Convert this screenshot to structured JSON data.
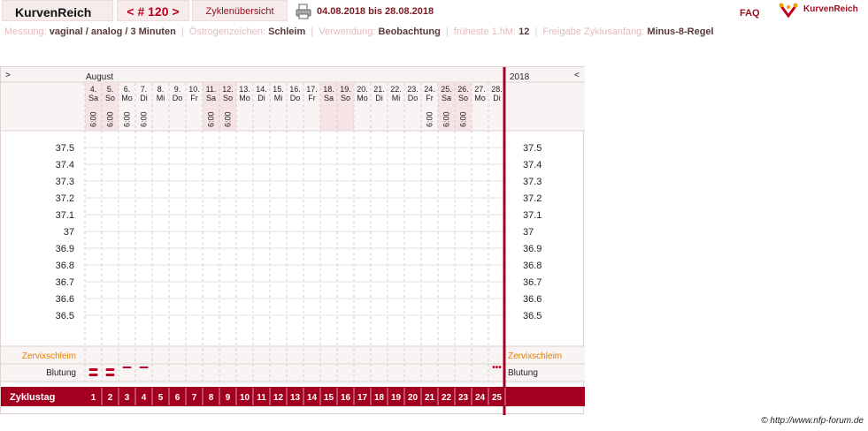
{
  "header": {
    "logo": "KurvenReich",
    "cycle_nav": "< # 120 >",
    "overview_button": "Zyklenübersicht",
    "date_range": "04.08.2018 bis 28.08.2018",
    "faq": "FAQ",
    "brand": "KurvenReich"
  },
  "info": {
    "measurement_label": "Messung:",
    "measurement_value": "vaginal / analog / 3 Minuten",
    "estrogen_label": "Östrogenzeichen:",
    "estrogen_value": "Schleim",
    "usage_label": "Verwendung:",
    "usage_value": "Beobachtung",
    "earliest_label": "früheste 1.hM:",
    "earliest_value": "12",
    "release_label": "Freigabe Zyklusanfang:",
    "release_value": "Minus-8-Regel"
  },
  "chart": {
    "nav_left": ">",
    "nav_right": "<",
    "month": "August",
    "year": "2018",
    "row_cervix": "Zervixschleim",
    "row_bleeding": "Blutung",
    "row_cycleday": "Zyklustag",
    "days": [
      {
        "d": "4.",
        "w": "Sa",
        "time": "6:00",
        "weekend": true
      },
      {
        "d": "5.",
        "w": "So",
        "time": "6:00",
        "weekend": true
      },
      {
        "d": "6.",
        "w": "Mo",
        "time": "6:00",
        "weekend": false
      },
      {
        "d": "7.",
        "w": "Di",
        "time": "6:00",
        "weekend": false
      },
      {
        "d": "8.",
        "w": "Mi",
        "time": "",
        "weekend": false
      },
      {
        "d": "9.",
        "w": "Do",
        "time": "",
        "weekend": false
      },
      {
        "d": "10.",
        "w": "Fr",
        "time": "",
        "weekend": false
      },
      {
        "d": "11.",
        "w": "Sa",
        "time": "6:00",
        "weekend": true
      },
      {
        "d": "12.",
        "w": "So",
        "time": "6:00",
        "weekend": true
      },
      {
        "d": "13.",
        "w": "Mo",
        "time": "",
        "weekend": false
      },
      {
        "d": "14.",
        "w": "Di",
        "time": "",
        "weekend": false
      },
      {
        "d": "15.",
        "w": "Mi",
        "time": "",
        "weekend": false
      },
      {
        "d": "16.",
        "w": "Do",
        "time": "",
        "weekend": false
      },
      {
        "d": "17.",
        "w": "Fr",
        "time": "",
        "weekend": false
      },
      {
        "d": "18.",
        "w": "Sa",
        "time": "",
        "weekend": true
      },
      {
        "d": "19.",
        "w": "So",
        "time": "",
        "weekend": true
      },
      {
        "d": "20.",
        "w": "Mo",
        "time": "",
        "weekend": false
      },
      {
        "d": "21.",
        "w": "Di",
        "time": "",
        "weekend": false
      },
      {
        "d": "22.",
        "w": "Mi",
        "time": "",
        "weekend": false
      },
      {
        "d": "23.",
        "w": "Do",
        "time": "",
        "weekend": false
      },
      {
        "d": "24.",
        "w": "Fr",
        "time": "6:00",
        "weekend": false
      },
      {
        "d": "25.",
        "w": "Sa",
        "time": "6:00",
        "weekend": true
      },
      {
        "d": "26.",
        "w": "So",
        "time": "6:00",
        "weekend": true
      },
      {
        "d": "27.",
        "w": "Mo",
        "time": "",
        "weekend": false
      },
      {
        "d": "28.",
        "w": "Di",
        "time": "",
        "weekend": false
      }
    ],
    "temps": [
      "37.5",
      "37.4",
      "37.3",
      "37.2",
      "37.1",
      "37",
      "36.9",
      "36.8",
      "36.7",
      "36.6",
      "36.5"
    ],
    "bleeding": [
      "heavy",
      "heavy",
      "light",
      "light",
      "",
      "",
      "",
      "",
      "",
      "",
      "",
      "",
      "",
      "",
      "",
      "",
      "",
      "",
      "",
      "",
      "",
      "",
      "",
      "",
      "spotting"
    ],
    "cycle_days": [
      "1",
      "2",
      "3",
      "4",
      "5",
      "6",
      "7",
      "8",
      "9",
      "10",
      "11",
      "12",
      "13",
      "14",
      "15",
      "16",
      "17",
      "18",
      "19",
      "20",
      "21",
      "22",
      "23",
      "24",
      "25"
    ],
    "colors": {
      "accent": "#a30021",
      "weekend": "#f5e3e6",
      "cervix_label": "#e08000"
    }
  },
  "footer": {
    "copyright": "© http://www.nfp-forum.de"
  }
}
